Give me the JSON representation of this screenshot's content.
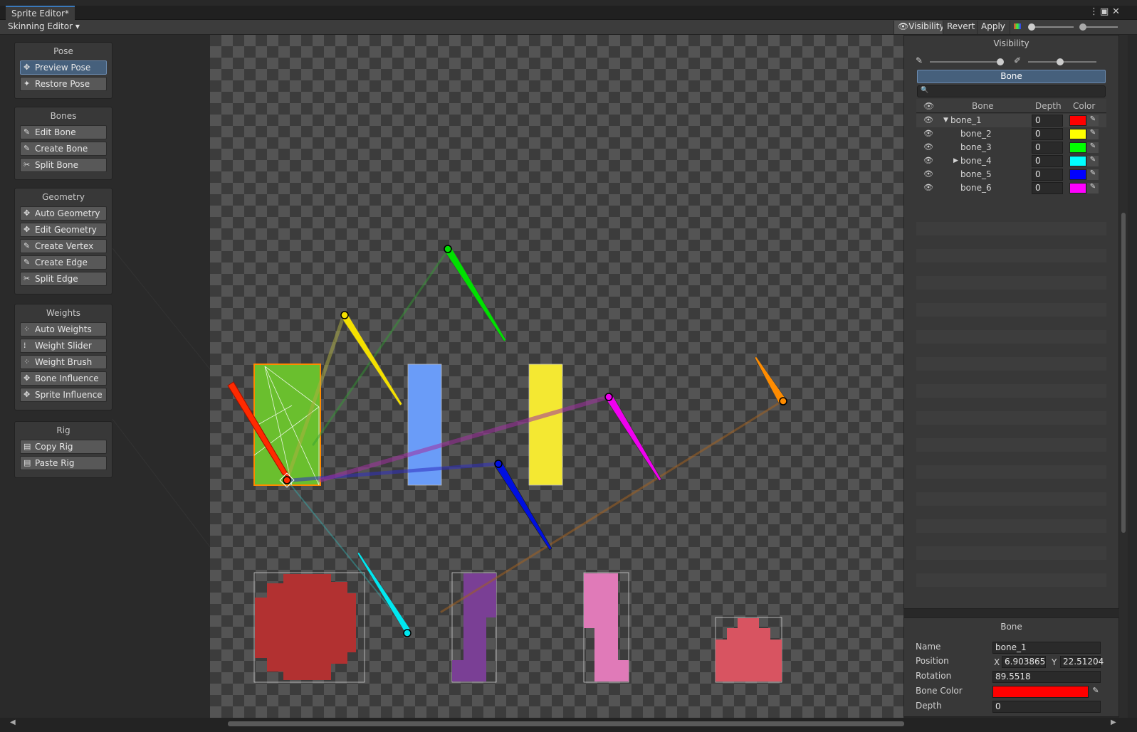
{
  "window": {
    "tab_title": "Sprite Editor*"
  },
  "toolbar": {
    "mode": "Skinning Editor",
    "visibility": "Visibility",
    "revert": "Revert",
    "apply": "Apply"
  },
  "tools": {
    "pose": {
      "title": "Pose",
      "items": [
        "Preview Pose",
        "Restore Pose"
      ]
    },
    "bones": {
      "title": "Bones",
      "items": [
        "Edit Bone",
        "Create Bone",
        "Split Bone"
      ]
    },
    "geometry": {
      "title": "Geometry",
      "items": [
        "Auto Geometry",
        "Edit Geometry",
        "Create Vertex",
        "Create Edge",
        "Split Edge"
      ]
    },
    "weights": {
      "title": "Weights",
      "items": [
        "Auto Weights",
        "Weight Slider",
        "Weight Brush",
        "Bone Influence",
        "Sprite Influence"
      ]
    },
    "rig": {
      "title": "Rig",
      "items": [
        "Copy Rig",
        "Paste Rig"
      ]
    }
  },
  "visibility_panel": {
    "title": "Visibility",
    "tab": "Bone",
    "columns": {
      "bone": "Bone",
      "depth": "Depth",
      "color": "Color"
    },
    "rows": [
      {
        "name": "bone_1",
        "depth": "0",
        "color": "#ff0000"
      },
      {
        "name": "bone_2",
        "depth": "0",
        "color": "#ffff00"
      },
      {
        "name": "bone_3",
        "depth": "0",
        "color": "#00ff00"
      },
      {
        "name": "bone_4",
        "depth": "0",
        "color": "#00ffff"
      },
      {
        "name": "bone_5",
        "depth": "0",
        "color": "#0000ff"
      },
      {
        "name": "bone_6",
        "depth": "0",
        "color": "#ff00ff"
      }
    ]
  },
  "inspector": {
    "title": "Bone",
    "name_label": "Name",
    "name": "bone_1",
    "position_label": "Position",
    "x_label": "X",
    "x": "6.903865",
    "y_label": "Y",
    "y": "22.51204",
    "rotation_label": "Rotation",
    "rotation": "89.5518",
    "color_label": "Bone Color",
    "color": "#ff0000",
    "depth_label": "Depth",
    "depth": "0"
  }
}
